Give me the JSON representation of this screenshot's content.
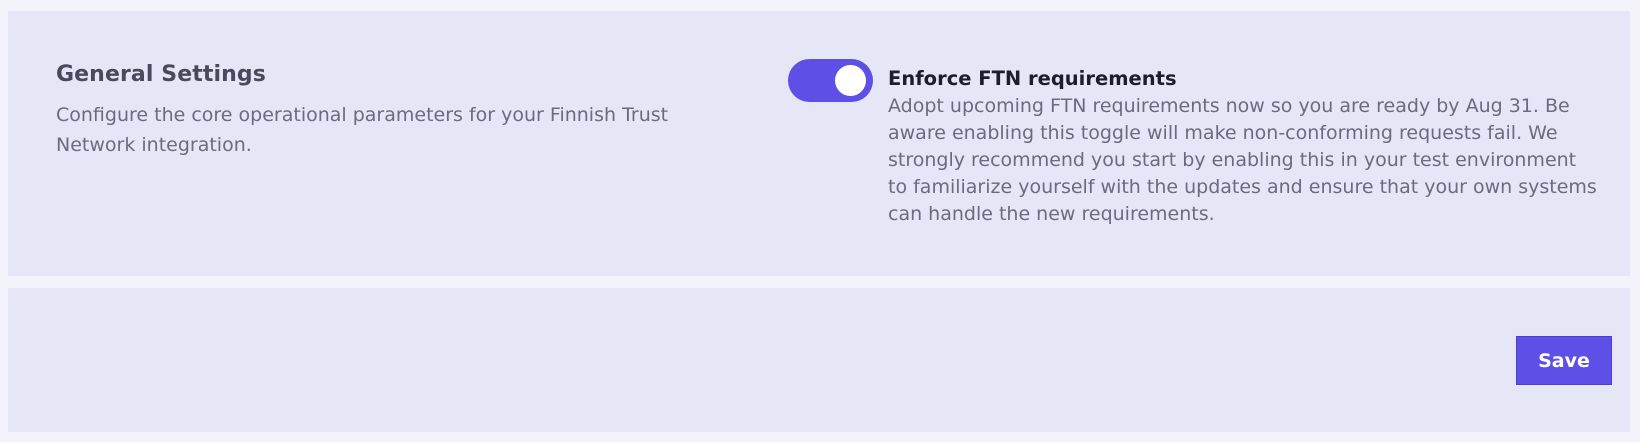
{
  "general_settings": {
    "title": "General Settings",
    "description": "Configure the core operational parameters for your Finnish Trust Network integration."
  },
  "enforce_ftn": {
    "enabled": true,
    "label": "Enforce FTN requirements",
    "description": "Adopt upcoming FTN requirements now so you are ready by Aug 31. Be aware enabling this toggle will make non-conforming requests fail. We strongly recommend you start by enabling this in your test environment to familiarize yourself with the updates and ensure that your own systems can handle the new requirements."
  },
  "actions": {
    "save_label": "Save"
  },
  "colors": {
    "accent": "#5e50e6",
    "panel_background": "#e5e7f6",
    "page_background": "#f3f3fb"
  }
}
